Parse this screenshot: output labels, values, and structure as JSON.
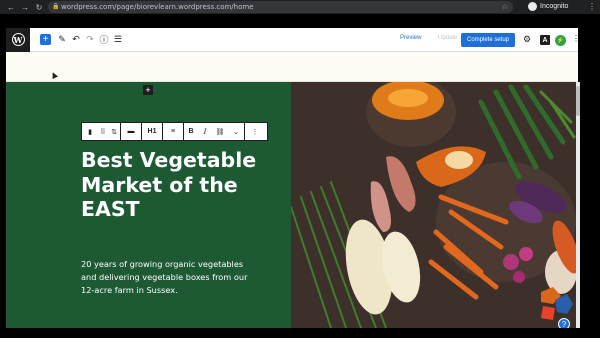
{
  "browser": {
    "url": "wordpress.com/page/biorevlearn.wordpress.com/home",
    "profile": "Incognito",
    "colors": {
      "chrome_bg": "#202124",
      "url_bar_bg": "#35363a"
    }
  },
  "editor_toolbar": {
    "preview_label": "Preview",
    "update_label": "Update",
    "complete_setup_label": "Complete setup",
    "astra_label": "A",
    "colors": {
      "accent": "#1e6fd9"
    }
  },
  "block_toolbar": {
    "heading_level_label": "H1",
    "bold_label": "B",
    "italic_label": "I"
  },
  "hero": {
    "heading": "Best Vegetable Market of the EAST",
    "description": "20 years of growing organic vegetables and delivering vegetable boxes from our 12-acre farm in Sussex.",
    "colors": {
      "panel_green": "#1d5a34"
    }
  },
  "icons": [
    "wordpress-icon",
    "plus-icon",
    "pen-icon",
    "undo-icon",
    "redo-icon",
    "info-icon",
    "list-view-icon",
    "gear-icon",
    "more-vertical-icon",
    "bookmark-icon",
    "drag-handle-icon",
    "align-icon",
    "link-icon",
    "chevron-down-icon",
    "help-icon"
  ]
}
